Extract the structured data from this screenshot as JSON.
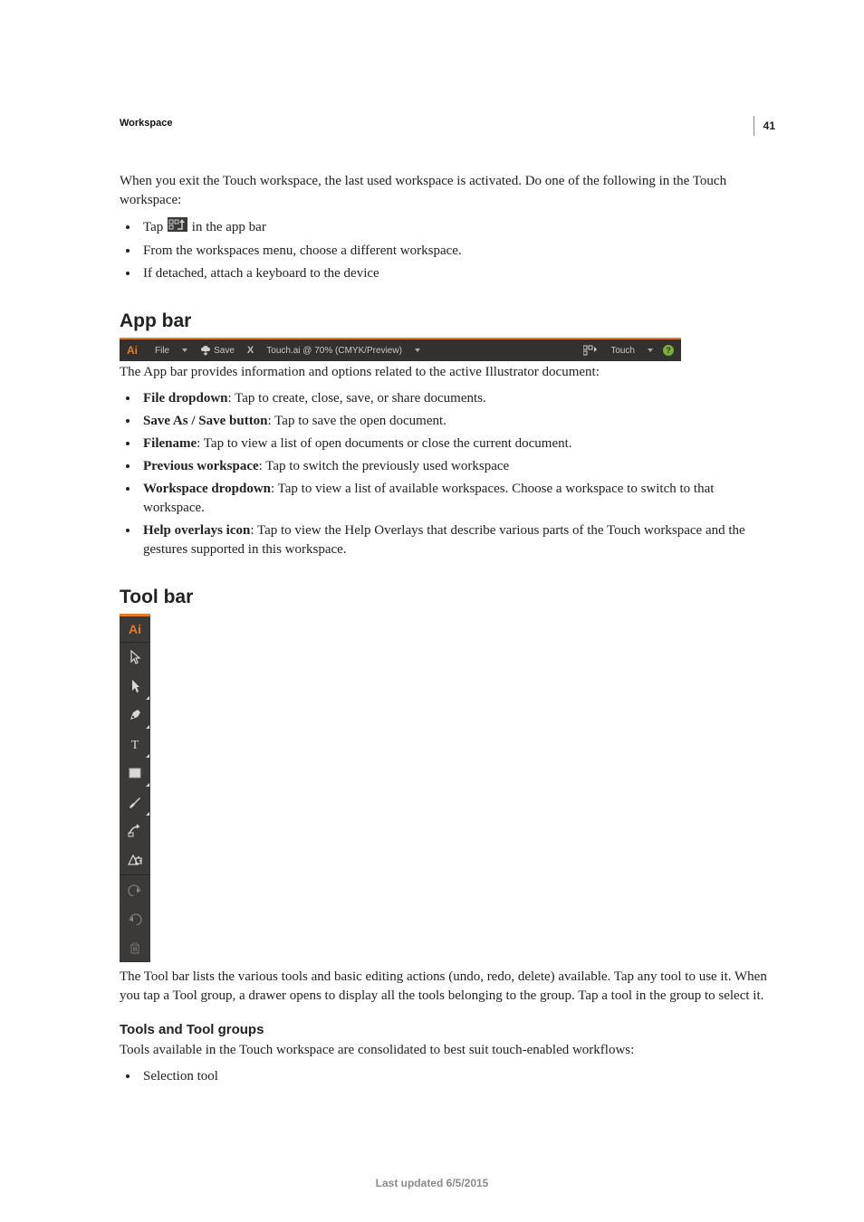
{
  "page_number": "41",
  "header": "Workspace",
  "intro": "When you exit the Touch workspace, the last used workspace is activated. Do one of the following in the Touch workspace:",
  "intro_bullets": {
    "tap_pre": "Tap ",
    "tap_post": " in the app bar",
    "b2": "From the workspaces menu, choose a different workspace.",
    "b3": "If detached, attach a keyboard to the device"
  },
  "appbar_section": {
    "heading": "App bar",
    "caption": "The App bar provides information and options related to the active Illustrator document:",
    "ui": {
      "ai": "Ai",
      "file": "File",
      "save": "Save",
      "close_x": "X",
      "filename": "Touch.ai @ 70% (CMYK/Preview)",
      "touch": "Touch",
      "help_q": "?"
    },
    "bullets": [
      {
        "term": "File dropdown",
        "desc": ": Tap to create, close, save, or share documents."
      },
      {
        "term": "Save As / Save button",
        "desc": ": Tap to save the open document."
      },
      {
        "term": "Filename",
        "desc": ": Tap to view a list of open documents or close the current document."
      },
      {
        "term": "Previous workspace",
        "desc": ": Tap to switch the previously used workspace"
      },
      {
        "term": "Workspace dropdown",
        "desc": ": Tap to view a list of available workspaces. Choose a workspace to switch to that workspace."
      },
      {
        "term": "Help overlays icon",
        "desc": ": Tap to view the Help Overlays that describe various parts of the Touch workspace and the gestures supported in this workspace."
      }
    ]
  },
  "toolbar_section": {
    "heading": "Tool bar",
    "ui": {
      "ai": "Ai"
    },
    "caption": "The Tool bar lists the various tools and basic editing actions (undo, redo, delete) available. Tap any tool to use it. When you tap a Tool group, a drawer opens to display all the tools belonging to the group. Tap a tool in the group to select it."
  },
  "tool_groups": {
    "heading": "Tools and Tool groups",
    "intro": "Tools available in the Touch workspace are consolidated to best suit touch-enabled workflows:",
    "bullets": [
      "Selection tool"
    ]
  },
  "footer": "Last updated 6/5/2015"
}
